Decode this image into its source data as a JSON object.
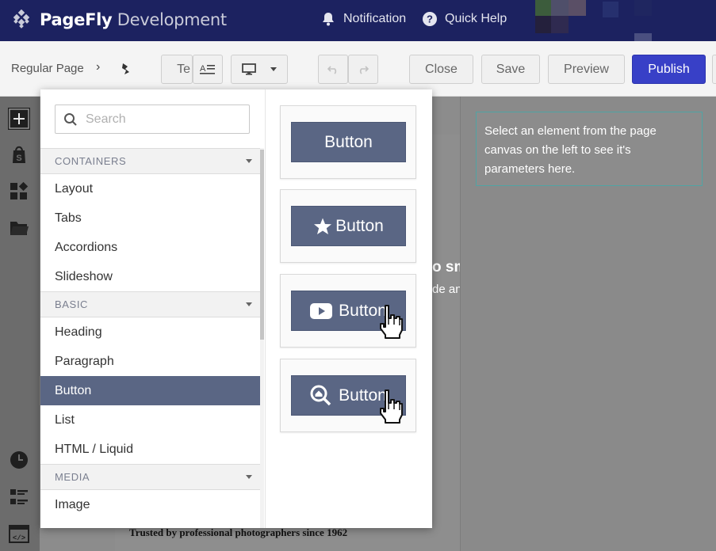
{
  "header": {
    "brand_bold": "PageFly",
    "brand_light": "Development",
    "notification_label": "Notification",
    "quick_help_label": "Quick Help",
    "background_color": "#1c2260"
  },
  "toolbar": {
    "breadcrumb": "Regular Page",
    "breadcrumb_separator": "›",
    "text_button_label": "Te",
    "close_label": "Close",
    "save_label": "Save",
    "preview_label": "Preview",
    "publish_label": "Publish",
    "publish_color": "#3840c7"
  },
  "left_rail": {
    "icons": [
      "add-icon",
      "shopify-bag-icon",
      "elements-grid-icon",
      "folder-icon",
      "history-icon",
      "layers-list-icon",
      "code-icon"
    ]
  },
  "element_picker": {
    "search": {
      "placeholder": "Search",
      "value": ""
    },
    "categories": [
      {
        "label": "CONTAINERS",
        "items": [
          "Layout",
          "Tabs",
          "Accordions",
          "Slideshow"
        ]
      },
      {
        "label": "BASIC",
        "items": [
          "Heading",
          "Paragraph",
          "Button",
          "List",
          "HTML / Liquid"
        ]
      },
      {
        "label": "MEDIA",
        "items": [
          "Image"
        ]
      }
    ],
    "selected_item": "Button",
    "variants": [
      {
        "label": "Button",
        "icon": "none"
      },
      {
        "label": "Button",
        "icon": "star-icon"
      },
      {
        "label": "Button",
        "icon": "youtube-play-icon"
      },
      {
        "label": "Button",
        "icon": "search-home-icon"
      }
    ],
    "accent_color": "#5a6684"
  },
  "canvas": {
    "overlay_title": "o small",
    "overlay_text": "de and get back to the Editor.",
    "footer_text": "Trusted by professional photographers since 1962"
  },
  "right_panel": {
    "hint": "Select an element from the page canvas on the left to see it's parameters here.",
    "hint_border_color": "#4fa4a4"
  }
}
